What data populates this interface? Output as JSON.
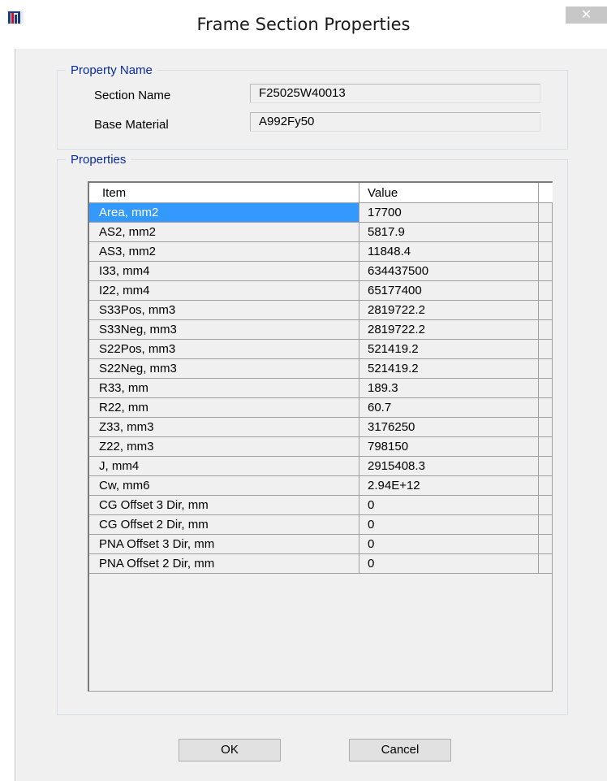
{
  "window": {
    "title": "Frame Section Properties",
    "close_glyph": "✕"
  },
  "property_name_group": {
    "legend": "Property Name",
    "section_name_label": "Section Name",
    "section_name_value": "F25025W40013",
    "base_material_label": "Base Material",
    "base_material_value": "A992Fy50"
  },
  "properties_group": {
    "legend": "Properties",
    "columns": {
      "item": "Item",
      "value": "Value"
    },
    "rows": [
      {
        "item": "Area, mm2",
        "value": "17700"
      },
      {
        "item": "AS2, mm2",
        "value": "5817.9"
      },
      {
        "item": "AS3, mm2",
        "value": "11848.4"
      },
      {
        "item": "I33, mm4",
        "value": "634437500"
      },
      {
        "item": "I22, mm4",
        "value": "65177400"
      },
      {
        "item": "S33Pos, mm3",
        "value": "2819722.2"
      },
      {
        "item": "S33Neg, mm3",
        "value": "2819722.2"
      },
      {
        "item": "S22Pos, mm3",
        "value": "521419.2"
      },
      {
        "item": "S22Neg, mm3",
        "value": "521419.2"
      },
      {
        "item": "R33, mm",
        "value": "189.3"
      },
      {
        "item": "R22, mm",
        "value": "60.7"
      },
      {
        "item": "Z33, mm3",
        "value": "3176250"
      },
      {
        "item": "Z22, mm3",
        "value": "798150"
      },
      {
        "item": "J, mm4",
        "value": "2915408.3"
      },
      {
        "item": "Cw, mm6",
        "value": "2.94E+12"
      },
      {
        "item": "CG Offset 3 Dir, mm",
        "value": "0"
      },
      {
        "item": "CG Offset 2 Dir, mm",
        "value": "0"
      },
      {
        "item": "PNA Offset 3 Dir, mm",
        "value": "0"
      },
      {
        "item": "PNA Offset 2 Dir, mm",
        "value": "0"
      }
    ],
    "selected_row": 0
  },
  "buttons": {
    "ok_label": "OK",
    "cancel_label": "Cancel"
  },
  "colors": {
    "selection": "#3399ff",
    "group_legend": "#0a2aa0",
    "dialog_background": "#f0f0f0"
  }
}
